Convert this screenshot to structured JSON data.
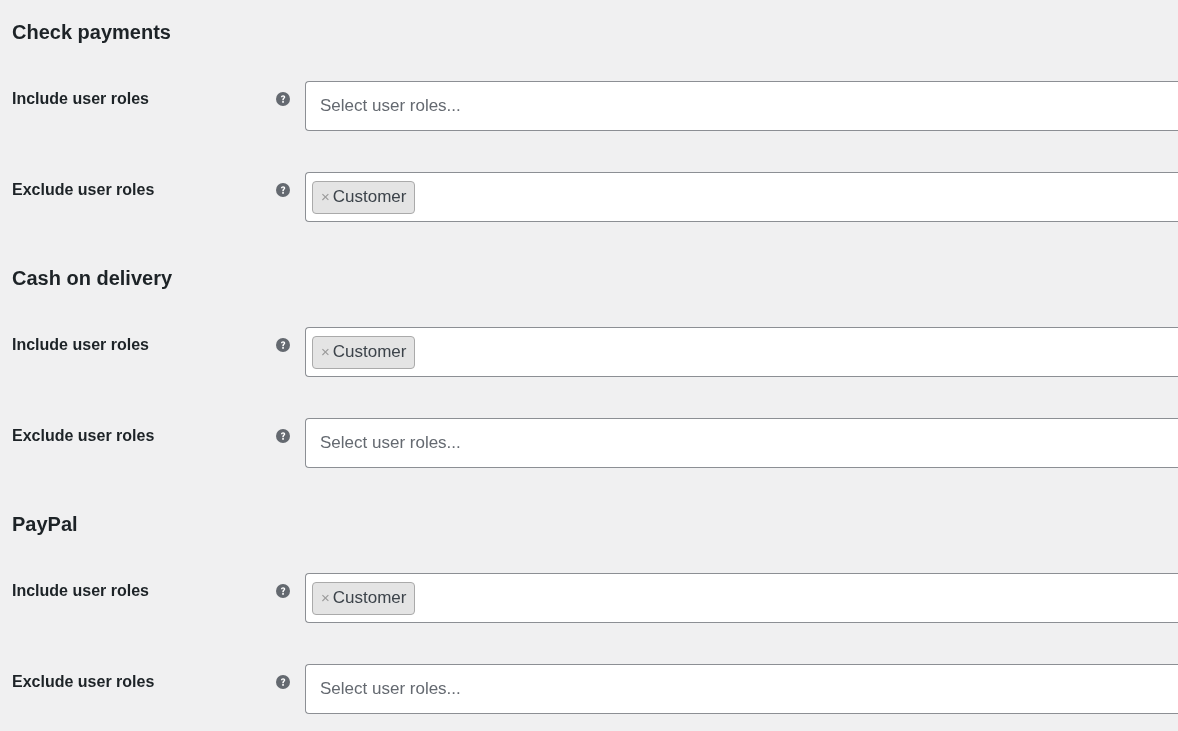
{
  "sections": [
    {
      "title": "Check payments",
      "fields": [
        {
          "label": "Include user roles",
          "placeholder": "Select user roles..."
        },
        {
          "label": "Exclude user roles",
          "tags": [
            {
              "remove": "×",
              "label": "Customer"
            }
          ]
        }
      ]
    },
    {
      "title": "Cash on delivery",
      "fields": [
        {
          "label": "Include user roles",
          "tags": [
            {
              "remove": "×",
              "label": "Customer"
            }
          ]
        },
        {
          "label": "Exclude user roles",
          "placeholder": "Select user roles..."
        }
      ]
    },
    {
      "title": "PayPal",
      "fields": [
        {
          "label": "Include user roles",
          "tags": [
            {
              "remove": "×",
              "label": "Customer"
            }
          ]
        },
        {
          "label": "Exclude user roles",
          "placeholder": "Select user roles..."
        }
      ]
    }
  ]
}
